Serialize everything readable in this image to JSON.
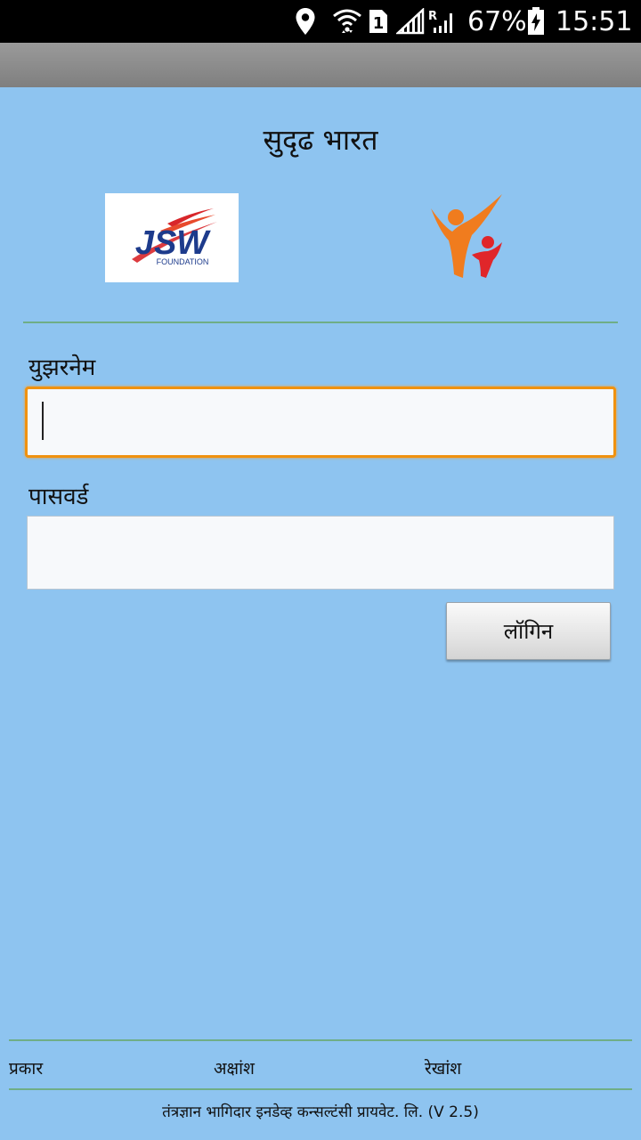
{
  "status_bar": {
    "battery_percent": "67%",
    "time": "15:51",
    "sim_slot": "1",
    "roaming_indicator": "R",
    "icons": [
      "location-icon",
      "wifi-icon",
      "sim-1-icon",
      "signal-icon",
      "signal-roaming-icon",
      "battery-charging-icon"
    ]
  },
  "app": {
    "title": "सुदृढ भारत",
    "jsw_logo_text": "JSW",
    "jsw_logo_subtext": "FOUNDATION"
  },
  "form": {
    "username_label": "युझरनेम",
    "username_value": "",
    "password_label": "पासवर्ड",
    "password_value": "",
    "login_label": "लॉगिन"
  },
  "footer": {
    "type_label": "प्रकार",
    "latitude_label": "अक्षांश",
    "longitude_label": "रेखांश",
    "credit": "तंत्रज्ञान भागिदार इनडेव्ह कन्सल्टंसी प्रायवेट. लि. (V 2.5)"
  },
  "colors": {
    "background": "#8ec4f0",
    "status_bar": "#000000",
    "action_bar": "#8c8c8c",
    "focus_border": "#f0920f",
    "divider": "#6fae86",
    "jsw_blue": "#1d3b8c",
    "jsw_red": "#d8262a",
    "partner_orange": "#f07c1e",
    "partner_red": "#e0262a"
  }
}
